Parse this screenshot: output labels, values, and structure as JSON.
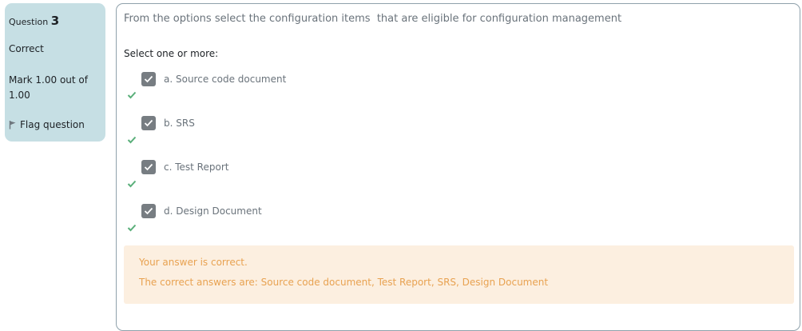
{
  "info": {
    "question_label": "Question",
    "question_number": "3",
    "state": "Correct",
    "grade": "Mark 1.00 out of 1.00",
    "flag_label": "Flag question"
  },
  "question": {
    "text": "From the options select the configuration items  that are eligible for configuration management",
    "prompt": "Select one or more:",
    "options": [
      {
        "label": "a. Source code document",
        "checked": true,
        "correct": true
      },
      {
        "label": "b. SRS",
        "checked": true,
        "correct": true
      },
      {
        "label": "c. Test Report",
        "checked": true,
        "correct": true
      },
      {
        "label": "d. Design Document",
        "checked": true,
        "correct": true
      }
    ]
  },
  "feedback": {
    "line1": "Your answer is correct.",
    "line2": "The correct answers are: Source code document, Test Report, SRS, Design Document"
  },
  "colors": {
    "info_bg": "#c6dfe4",
    "checkbox": "#777d82",
    "tick": "#5aaf7a",
    "feedback_bg": "#fcefe0",
    "feedback_text": "#e8a251"
  }
}
